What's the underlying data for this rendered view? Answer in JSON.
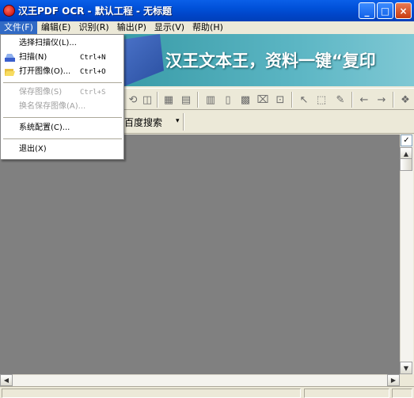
{
  "window": {
    "title": "汉王PDF OCR - 默认工程 - 无标题",
    "minimize_glyph": "_",
    "maximize_glyph": "□",
    "close_glyph": "×"
  },
  "menubar": [
    {
      "label": "文件(F)",
      "active": true
    },
    {
      "label": "编辑(E)"
    },
    {
      "label": "识别(R)"
    },
    {
      "label": "输出(P)"
    },
    {
      "label": "显示(V)"
    },
    {
      "label": "帮助(H)"
    }
  ],
  "banner": {
    "text": "汉王文本王，资料一键“复印"
  },
  "toolbar": {
    "icons": [
      "rotate-icon",
      "view-icon",
      "layout-icon",
      "split-icon",
      "page-icon",
      "columns-icon",
      "table-icon",
      "erase-icon",
      "select-icon",
      "pointer-icon",
      "crop-icon",
      "pen-icon",
      "back-icon",
      "forward-icon",
      "recognize-icon"
    ]
  },
  "search": {
    "engine_label": "百度搜索",
    "dropdown_glyph": "▾"
  },
  "file_menu": {
    "items": [
      {
        "label": "选择扫描仪(L)...",
        "shortcut": "",
        "disabled": false,
        "icon": ""
      },
      {
        "label": "扫描(N)",
        "shortcut": "Ctrl+N",
        "disabled": false,
        "icon": "scanner-icon"
      },
      {
        "label": "打开图像(O)...",
        "shortcut": "Ctrl+O",
        "disabled": false,
        "icon": "open-folder-icon"
      },
      {
        "label": "保存图像(S)",
        "shortcut": "Ctrl+S",
        "disabled": true,
        "icon": ""
      },
      {
        "label": "换名保存图像(A)...",
        "shortcut": "",
        "disabled": true,
        "icon": ""
      },
      {
        "label": "系统配置(C)...",
        "shortcut": "",
        "disabled": false,
        "icon": ""
      },
      {
        "label": "退出(X)",
        "shortcut": "",
        "disabled": false,
        "icon": ""
      }
    ]
  },
  "workspace": {
    "check_glyph": "✓",
    "scroll_up_glyph": "▲",
    "scroll_down_glyph": "▼",
    "scroll_left_glyph": "◀",
    "scroll_right_glyph": "▶"
  },
  "colors": {
    "titlebar": "#0050d8",
    "menu_highlight": "#316ac5",
    "workspace": "#808080",
    "banner": "#5cb6c4"
  }
}
